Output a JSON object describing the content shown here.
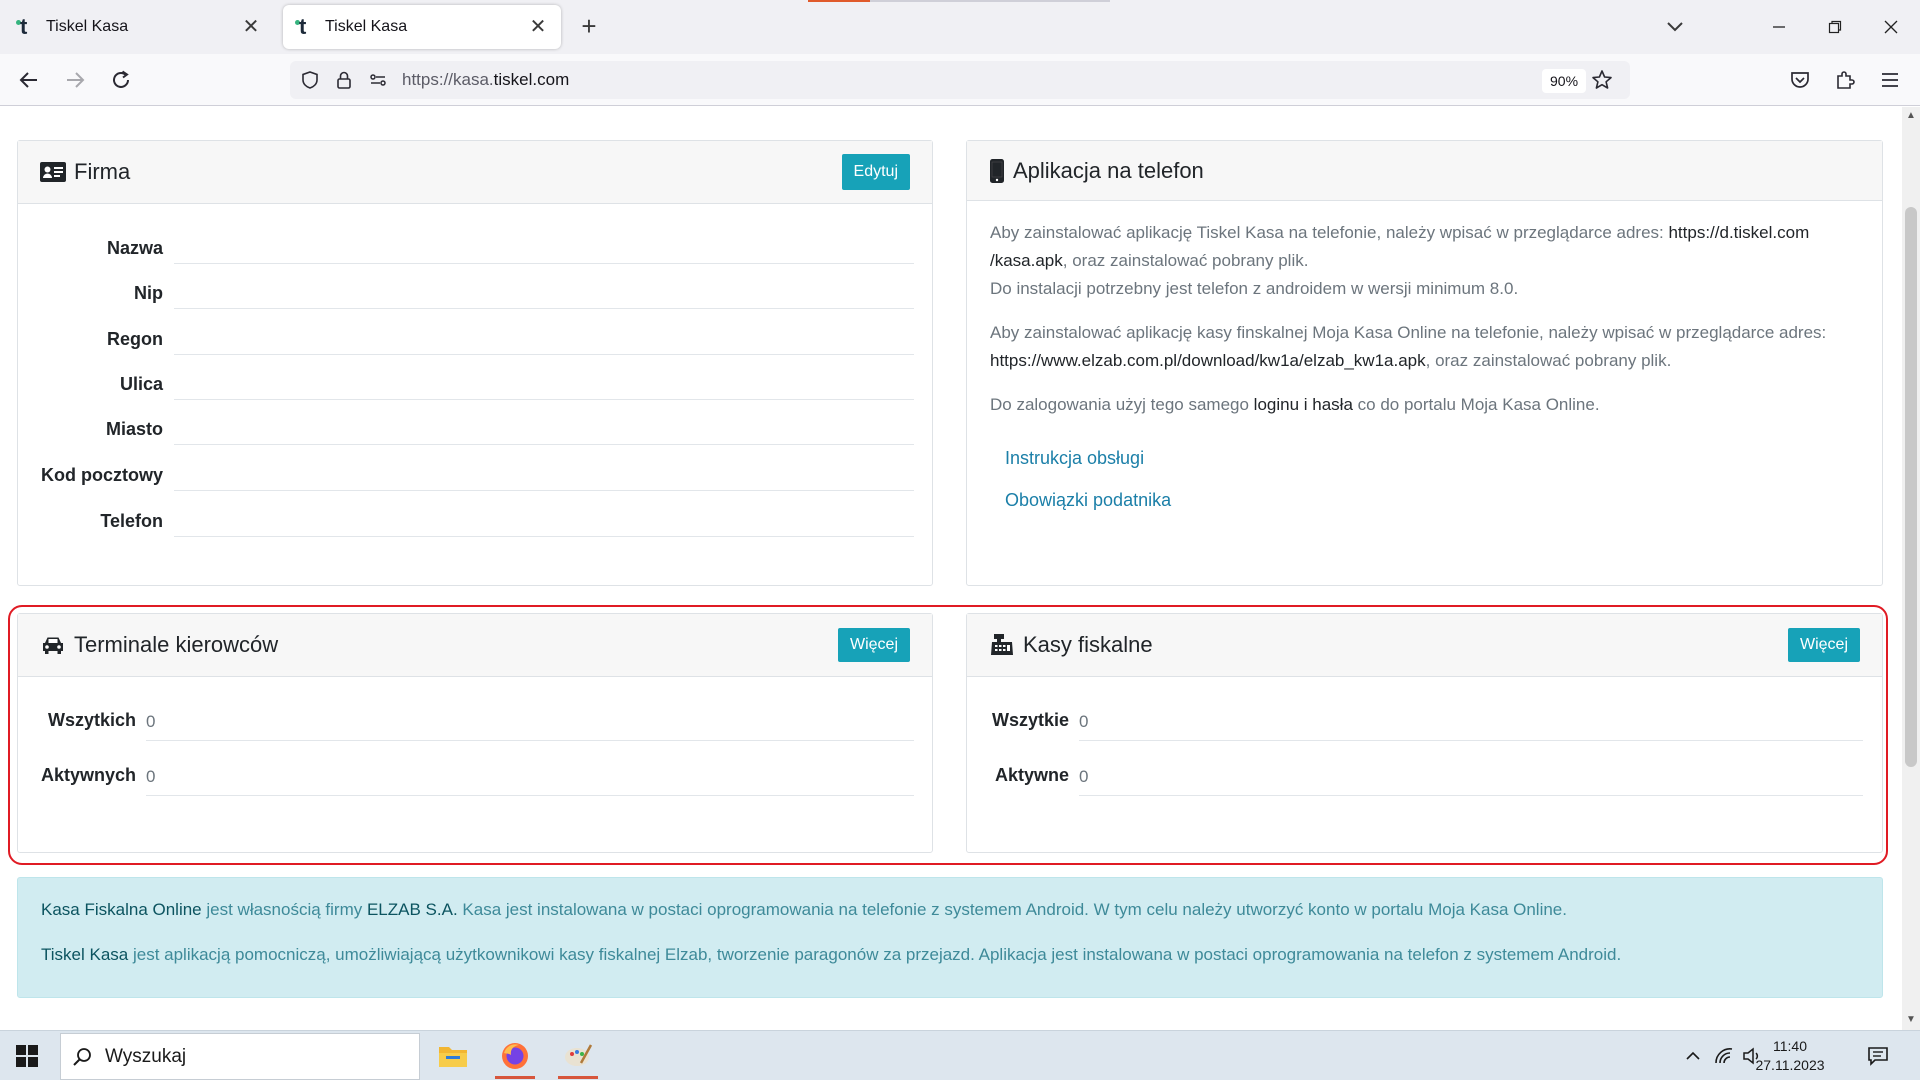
{
  "browser": {
    "tabs": [
      {
        "title": "Tiskel Kasa",
        "active": false
      },
      {
        "title": "Tiskel Kasa",
        "active": true
      }
    ],
    "url_prefix": "https://kasa.",
    "url_host": "tiskel.com",
    "zoom": "90%"
  },
  "firma": {
    "title": "Firma",
    "edit_label": "Edytuj",
    "fields": [
      {
        "label": "Nazwa",
        "value": ""
      },
      {
        "label": "Nip",
        "value": ""
      },
      {
        "label": "Regon",
        "value": ""
      },
      {
        "label": "Ulica",
        "value": ""
      },
      {
        "label": "Miasto",
        "value": ""
      },
      {
        "label": "Kod pocztowy",
        "value": ""
      },
      {
        "label": "Telefon",
        "value": ""
      }
    ]
  },
  "aplikacja": {
    "title": "Aplikacja na telefon",
    "p1_a": "Aby zainstalować aplikację Tiskel Kasa na telefonie, należy wpisać w przeglądarce adres: ",
    "p1_url1": "https://d.tiskel.com",
    "p1_url2": "/kasa.apk",
    "p1_b": ", oraz zainstalować pobrany plik.",
    "p1_c": "Do instalacji potrzebny jest telefon z androidem w wersji minimum 8.0.",
    "p2_a": "Aby zainstalować aplikację kasy finskalnej Moja Kasa Online na telefonie, należy wpisać w przeglądarce adres:",
    "p2_url": "https://www.elzab.com.pl/download/kw1a/elzab_kw1a.apk",
    "p2_b": ", oraz zainstalować pobrany plik.",
    "p3_a": "Do zalogowania użyj tego samego ",
    "p3_bold": "loginu i hasła",
    "p3_b": " co do portalu Moja Kasa Online.",
    "link1": "Instrukcja obsługi",
    "link2": "Obowiązki podatnika"
  },
  "terminale": {
    "title": "Terminale kierowców",
    "more_label": "Więcej",
    "rows": [
      {
        "label": "Wszytkich",
        "value": "0"
      },
      {
        "label": "Aktywnych",
        "value": "0"
      }
    ]
  },
  "kasy": {
    "title": "Kasy fiskalne",
    "more_label": "Więcej",
    "rows": [
      {
        "label": "Wszytkie",
        "value": "0"
      },
      {
        "label": "Aktywne",
        "value": "0"
      }
    ]
  },
  "footer_info": {
    "l1_name": "Kasa Fiskalna Online",
    "l1_a": " jest własnością firmy ",
    "l1_company": "ELZAB S.A.",
    "l1_b": " Kasa jest instalowana w postaci oprogramowania na telefonie z systemem Android. W tym celu należy utworzyć konto w portalu Moja Kasa Online.",
    "l2_name": "Tiskel Kasa",
    "l2_a": " jest aplikacją pomocniczą, umożliwiającą użytkownikowi kasy fiskalnej Elzab, tworzenie paragonów za przejazd. Aplikacja jest instalowana w postaci oprogramowania na telefon z systemem Android."
  },
  "taskbar": {
    "search_placeholder": "Wyszukaj",
    "time": "11:40",
    "date": "27.11.2023"
  },
  "colors": {
    "accent_button": "#17a2b8",
    "alert_bg": "#d1ecf1",
    "highlight_outline": "#e01b24"
  }
}
